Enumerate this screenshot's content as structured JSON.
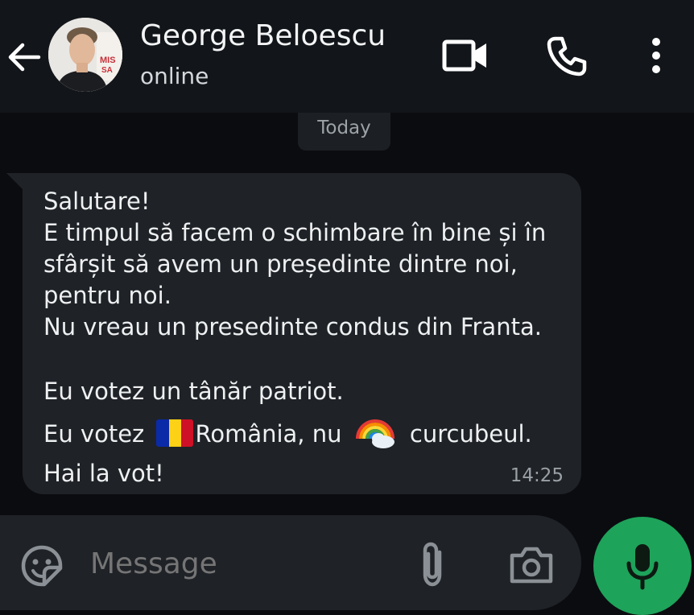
{
  "header": {
    "contact_name": "George Beloescu",
    "status": "online",
    "icons": [
      "back-arrow-icon",
      "video-call-icon",
      "phone-icon",
      "more-options-icon"
    ]
  },
  "chat": {
    "date_label": "Today",
    "message": {
      "lines": [
        "Salutare!",
        "E timpul să facem o schimbare în bine și în",
        "sfârșit să avem un președinte dintre noi,",
        "pentru noi.",
        "Nu vreau un presedinte condus din Franta."
      ],
      "line6": "Eu votez un tânăr patriot.",
      "line7_a": "Eu votez ",
      "line7_b": "România, nu ",
      "line7_c": " curcubeul.",
      "line8": "Hai la vot!",
      "time": "14:25",
      "emoji": [
        "romania-flag",
        "rainbow"
      ]
    }
  },
  "composer": {
    "placeholder": "Message",
    "icons": [
      "sticker-icon",
      "attach-icon",
      "camera-icon",
      "mic-icon"
    ]
  },
  "colors": {
    "background": "#0b0c10",
    "bubble": "#1f2227",
    "mic_button": "#1ea35a"
  }
}
